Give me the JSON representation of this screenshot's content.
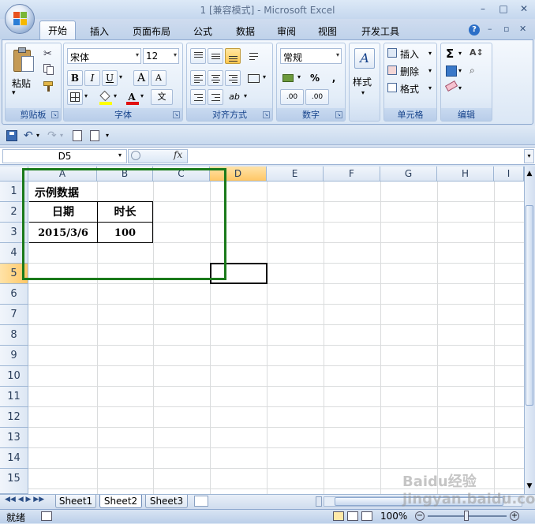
{
  "window": {
    "title": "1 [兼容模式] - Microsoft Excel",
    "controls": [
      "–",
      "□",
      "✕"
    ]
  },
  "tabs": [
    "开始",
    "插入",
    "页面布局",
    "公式",
    "数据",
    "审阅",
    "视图",
    "开发工具"
  ],
  "ribbon": {
    "clipboard": {
      "label": "剪贴板",
      "paste": "粘贴"
    },
    "font": {
      "label": "字体",
      "name": "宋体",
      "size": "12",
      "bold": "B",
      "italic": "I",
      "underline": "U",
      "grow": "A",
      "shrink": "A",
      "phonetic": "文"
    },
    "alignment": {
      "label": "对齐方式"
    },
    "number": {
      "label": "数字",
      "format": "常规",
      "percent": "%",
      "comma": ",",
      "inc": ".00",
      "dec": ".00"
    },
    "styles": {
      "label": "样式"
    },
    "cells": {
      "label": "单元格",
      "insert": "插入",
      "delete": "删除",
      "format": "格式"
    },
    "editing": {
      "label": "编辑",
      "sum": "Σ"
    }
  },
  "formula_bar": {
    "name_box": "D5",
    "fx": "fx",
    "value": ""
  },
  "columns": [
    "A",
    "B",
    "C",
    "D",
    "E",
    "F",
    "G",
    "H",
    "I"
  ],
  "rows": [
    "1",
    "2",
    "3",
    "4",
    "5",
    "6",
    "7",
    "8",
    "9",
    "10",
    "11",
    "12",
    "13",
    "14",
    "15"
  ],
  "cells": {
    "A1": "示例数据",
    "A2": "日期",
    "B2": "时长",
    "A3": "2015/3/6",
    "B3": "100"
  },
  "sheets": [
    "Sheet1",
    "Sheet2",
    "Sheet3"
  ],
  "active_sheet": "Sheet2",
  "status": {
    "ready": "就绪",
    "zoom": "100%"
  },
  "watermark": "Baidu经验 jingyan.baidu.com",
  "colors": {
    "accent": "#15428b",
    "highlight_box": "#1a7a1a"
  }
}
